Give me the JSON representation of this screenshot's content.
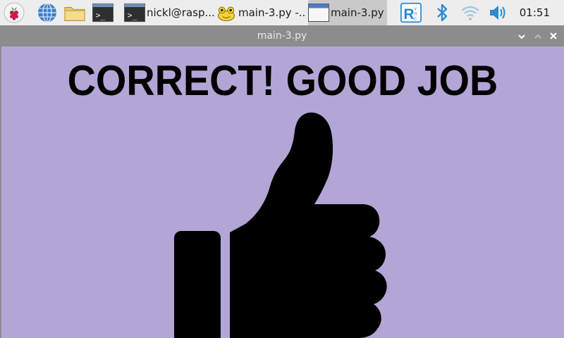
{
  "taskbar": {
    "apps": [
      {
        "name": "raspberry-menu",
        "icon": "raspberry-icon"
      },
      {
        "name": "web-browser",
        "icon": "globe-icon"
      },
      {
        "name": "file-manager",
        "icon": "folder-icon"
      },
      {
        "name": "terminal",
        "icon": "terminal-icon"
      }
    ],
    "tasks": [
      {
        "label": "nickl@rasp...",
        "icon": "terminal-icon",
        "active": false
      },
      {
        "label": "main-3.py -...",
        "icon": "thonny-icon",
        "active": false
      },
      {
        "label": "main-3.py",
        "icon": "window-icon",
        "active": true
      }
    ],
    "tray": [
      "vnc-icon",
      "bluetooth-icon",
      "wifi-icon",
      "volume-icon"
    ],
    "clock": "01:51"
  },
  "window": {
    "title": "main-3.py",
    "background_color": "#b3a6d6",
    "headline": "CORRECT! GOOD JOB",
    "graphic": "thumbs-up-icon"
  }
}
